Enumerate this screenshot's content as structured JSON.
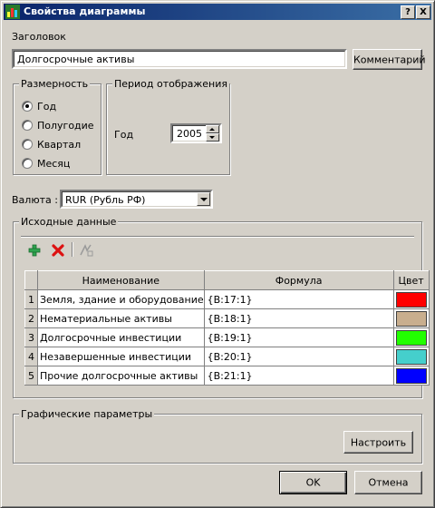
{
  "title": "Свойства диаграммы",
  "title_buttons": {
    "help": "?",
    "close": "X"
  },
  "header_label": "Заголовок",
  "header_value": "Долгосрочные активы",
  "comment_button": "Комментарий",
  "dimension": {
    "legend": "Размерность",
    "options": [
      "Год",
      "Полугодие",
      "Квартал",
      "Месяц"
    ],
    "selected": "Год"
  },
  "period": {
    "legend": "Период отображения",
    "label": "Год",
    "value": "2005"
  },
  "currency": {
    "label": "Валюта :",
    "value": "RUR (Рубль РФ)"
  },
  "source": {
    "legend": "Исходные данные",
    "columns": [
      "Наименование",
      "Формула",
      "Цвет"
    ],
    "rows": [
      {
        "num": "1",
        "name": "Земля, здание и оборудование",
        "formula": "{B:17:1}",
        "color": "#ff0000"
      },
      {
        "num": "2",
        "name": "Нематериальные активы",
        "formula": "{B:18:1}",
        "color": "#c8ae8e"
      },
      {
        "num": "3",
        "name": "Долгосрочные инвестиции",
        "formula": "{B:19:1}",
        "color": "#22ff00"
      },
      {
        "num": "4",
        "name": "Незавершенные инвестиции",
        "formula": "{B:20:1}",
        "color": "#45cfcc"
      },
      {
        "num": "5",
        "name": "Прочие долгосрочные активы",
        "formula": "{B:21:1}",
        "color": "#0000ff"
      }
    ]
  },
  "graphic": {
    "legend": "Графические параметры",
    "button": "Настроить"
  },
  "ok_button": "OK",
  "cancel_button": "Отмена"
}
